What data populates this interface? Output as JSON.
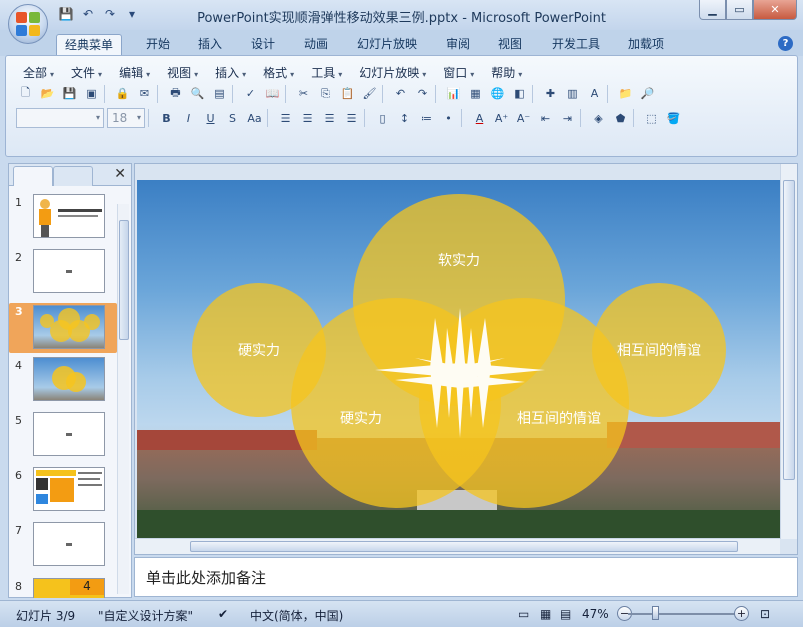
{
  "window": {
    "title": "PowerPoint实现顺滑弹性移动效果三例.pptx - Microsoft PowerPoint",
    "controls": [
      "minimize",
      "maximize",
      "close"
    ]
  },
  "ribbon_tabs": [
    "经典菜单",
    "开始",
    "插入",
    "设计",
    "动画",
    "幻灯片放映",
    "审阅",
    "视图",
    "开发工具",
    "加载项"
  ],
  "active_tab": "经典菜单",
  "menus": [
    "全部",
    "文件",
    "编辑",
    "视图",
    "插入",
    "格式",
    "工具",
    "幻灯片放映",
    "窗口",
    "帮助"
  ],
  "font": {
    "name": "",
    "size": "18"
  },
  "slides": [
    {
      "num": "1"
    },
    {
      "num": "2"
    },
    {
      "num": "3"
    },
    {
      "num": "4"
    },
    {
      "num": "5"
    },
    {
      "num": "6"
    },
    {
      "num": "7"
    },
    {
      "num": "8"
    }
  ],
  "selected_slide": "3",
  "slide_content": {
    "bubbles": {
      "b1": "软实力",
      "b2": "硬实力",
      "b3": "相互间的情谊",
      "b4": "硬实力",
      "b5": "相互间的情谊"
    }
  },
  "thumb8_label": "4",
  "notes_placeholder": "单击此处添加备注",
  "status": {
    "slide_info": "幻灯片 3/9",
    "theme": "\"自定义设计方案\"",
    "language": "中文(简体，中国)",
    "zoom": "47%"
  },
  "colors": {
    "accent": "#f5c21c",
    "selected": "#f0a55a"
  }
}
